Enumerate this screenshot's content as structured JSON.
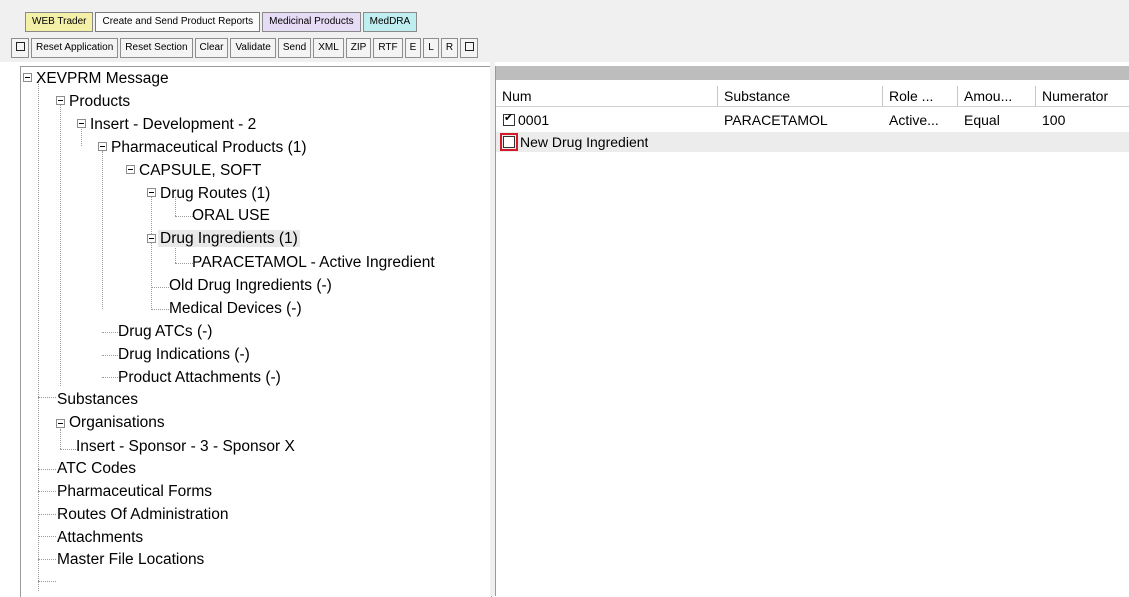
{
  "tabs": [
    {
      "label": "WEB Trader"
    },
    {
      "label": "Create and Send Product Reports"
    },
    {
      "label": "Medicinal Products"
    },
    {
      "label": "MedDRA"
    }
  ],
  "toolbar": {
    "reset_application": "Reset Application",
    "reset_section": "Reset Section",
    "clear": "Clear",
    "validate": "Validate",
    "send": "Send",
    "xml": "XML",
    "zip": "ZIP",
    "rtf": "RTF",
    "e": "E",
    "l": "L",
    "r": "R"
  },
  "tree": {
    "root": "XEVPRM Message",
    "products": "Products",
    "insert_dev": "Insert - Development - 2",
    "pharm_products": "Pharmaceutical Products (1)",
    "capsule": "CAPSULE, SOFT",
    "drug_routes": "Drug Routes (1)",
    "oral_use": "ORAL USE",
    "drug_ingredients": "Drug Ingredients (1)",
    "paracetamol": "PARACETAMOL - Active Ingredient",
    "old_ingredients": "Old Drug Ingredients (-)",
    "medical_devices": "Medical Devices (-)",
    "drug_atcs": "Drug ATCs (-)",
    "drug_indications": "Drug Indications (-)",
    "product_attachments": "Product Attachments (-)",
    "substances": "Substances",
    "organisations": "Organisations",
    "insert_sponsor": "Insert - Sponsor - 3 - Sponsor X",
    "atc_codes": "ATC Codes",
    "pharm_forms": "Pharmaceutical Forms",
    "routes_admin": "Routes Of Administration",
    "attachments": "Attachments",
    "master_file": "Master File Locations"
  },
  "grid": {
    "columns": [
      "Num",
      "Substance",
      "Role ...",
      "Amou...",
      "Numerator"
    ],
    "rows": [
      {
        "checked": true,
        "num": "0001",
        "substance": "PARACETAMOL",
        "role": "Active...",
        "amount": "Equal",
        "numerator": "100"
      },
      {
        "checked": false,
        "num": "New Drug Ingredient"
      }
    ]
  },
  "colors": {
    "highlight_box": "#d11a2a"
  }
}
